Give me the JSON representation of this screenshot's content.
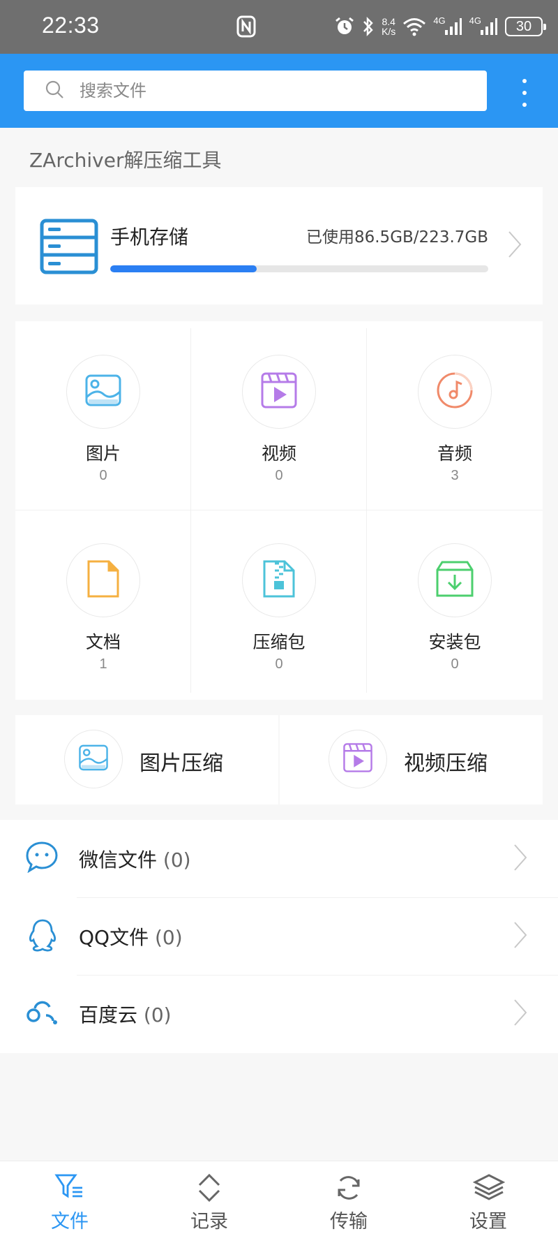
{
  "status_bar": {
    "time": "22:33",
    "net_speed_value": "8.4",
    "net_speed_unit": "K/s",
    "signal1_label": "4G",
    "signal2_label": "4G",
    "battery": "30"
  },
  "header": {
    "search_placeholder": "搜索文件"
  },
  "app_title": "ZArchiver解压缩工具",
  "storage": {
    "label": "手机存储",
    "used_text": "已使用86.5GB/223.7GB",
    "used_fraction": 0.387
  },
  "categories": [
    {
      "name": "图片",
      "count": "0",
      "color": "#4cb3e8"
    },
    {
      "name": "视频",
      "count": "0",
      "color": "#b57be8"
    },
    {
      "name": "音频",
      "count": "3",
      "color": "#f08a6a"
    },
    {
      "name": "文档",
      "count": "1",
      "color": "#f5b041"
    },
    {
      "name": "压缩包",
      "count": "0",
      "color": "#4cc3d9"
    },
    {
      "name": "安装包",
      "count": "0",
      "color": "#4ccf6e"
    }
  ],
  "compress": [
    {
      "name": "图片压缩"
    },
    {
      "name": "视频压缩"
    }
  ],
  "list": [
    {
      "label": "微信文件",
      "count": "(0)"
    },
    {
      "label": "QQ文件",
      "count": "(0)"
    },
    {
      "label": "百度云",
      "count": "(0)"
    }
  ],
  "bottom_nav": [
    {
      "label": "文件",
      "active": true
    },
    {
      "label": "记录",
      "active": false
    },
    {
      "label": "传输",
      "active": false
    },
    {
      "label": "设置",
      "active": false
    }
  ],
  "colors": {
    "accent": "#2b96f3",
    "progress": "#2b7ff3",
    "icon_blue": "#2a8fd4"
  }
}
